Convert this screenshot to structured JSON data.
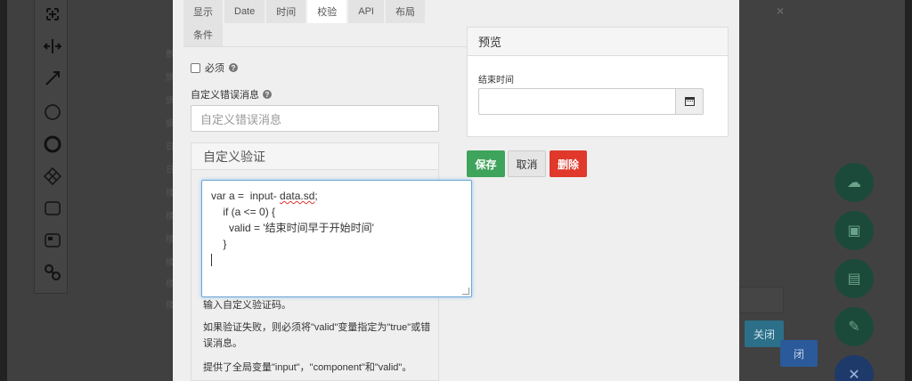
{
  "tabs": [
    "显示",
    "Date",
    "时间",
    "校验",
    "API",
    "布局",
    "条件"
  ],
  "active_tab": "校验",
  "required": {
    "label": "必须",
    "checked": false
  },
  "custom_error": {
    "label": "自定义错误消息",
    "placeholder": "自定义错误消息"
  },
  "custom_validation": {
    "title": "自定义验证",
    "code_lines": [
      "var a =  input- data.sd;",
      "    if (a <= 0) {",
      "      valid = '结束时间早于开始时间'",
      "    }"
    ],
    "help_1": "输入自定义验证码。",
    "help_2": "如果验证失败，则必须将\"valid\"变量指定为\"true\"或错误消息。",
    "help_3": "提供了全局变量\"input\"，\"component\"和\"valid\"。"
  },
  "preview": {
    "title": "预览",
    "field_label": "结束时间"
  },
  "buttons": {
    "save": "保存",
    "cancel": "取消",
    "delete": "删除"
  },
  "background": {
    "close_label": "关闭",
    "close_label_2": "闭",
    "list_letters": [
      "數",
      "旗",
      "旗",
      "旗",
      "日",
      "日",
      "楼",
      "楼",
      "楼",
      "楼",
      "楼",
      "楼"
    ]
  },
  "colors": {
    "save": "#3fa45b",
    "delete": "#e0392b",
    "focus": "#6ea6d8"
  }
}
